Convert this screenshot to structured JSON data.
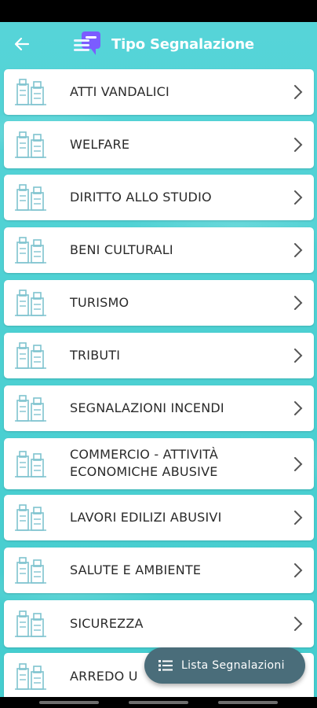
{
  "header": {
    "title": "Tipo Segnalazione",
    "back_icon": "arrow-left-icon",
    "logo_icon": "report-list-icon"
  },
  "items": [
    {
      "label": "ATTI VANDALICI"
    },
    {
      "label": "WELFARE"
    },
    {
      "label": "DIRITTO ALLO STUDIO"
    },
    {
      "label": "BENI CULTURALI"
    },
    {
      "label": "TURISMO"
    },
    {
      "label": "TRIBUTI"
    },
    {
      "label": "SEGNALAZIONI INCENDI"
    },
    {
      "label_line1": "COMMERCIO - ATTIVITÀ",
      "label_line2": "ECONOMICHE ABUSIVE"
    },
    {
      "label": "LAVORI EDILIZI ABUSIVI"
    },
    {
      "label": "SALUTE E AMBIENTE"
    },
    {
      "label": "SICUREZZA"
    },
    {
      "label": "ARREDO U"
    }
  ],
  "fab": {
    "label": "Lista Segnalazioni",
    "icon": "list-icon"
  },
  "colors": {
    "background": "#4cd0d2",
    "card": "#ffffff",
    "fab": "#4a6d7a",
    "icon_accent": "#7fc3cf"
  }
}
